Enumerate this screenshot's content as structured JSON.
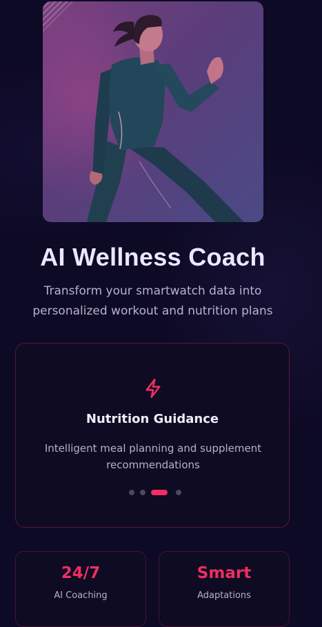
{
  "hero": {
    "title": "AI Wellness Coach",
    "subtitle": "Transform your smartwatch data into personalized workout and nutrition plans"
  },
  "feature_carousel": {
    "icon": "lightning-bolt-icon",
    "title": "Nutrition Guidance",
    "description": "Intelligent meal planning and supplement recommendations",
    "total_slides": 4,
    "active_slide": 3
  },
  "stats": [
    {
      "value": "24/7",
      "label": "AI Coaching"
    },
    {
      "value": "Smart",
      "label": "Adaptations"
    }
  ],
  "colors": {
    "background": "#0d0a25",
    "accent": "#ef2e63",
    "card": "#0e0b22"
  }
}
